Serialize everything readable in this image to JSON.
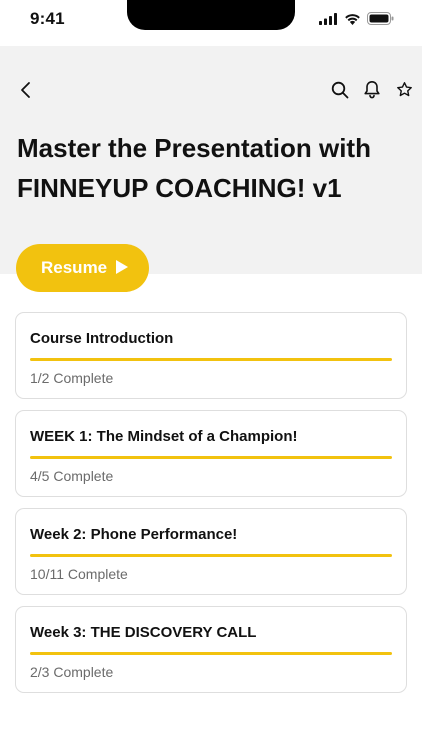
{
  "status_bar": {
    "time": "9:41",
    "icons": [
      "cellular-signal-icon",
      "wifi-icon",
      "battery-icon"
    ]
  },
  "header": {
    "icons": [
      "chevron-left-icon",
      "search-icon",
      "bell-icon",
      "star-icon"
    ]
  },
  "course": {
    "title": "Master the Presentation with FINNEYUP COACHING! v1",
    "resume_label": "Resume"
  },
  "colors": {
    "accent": "#f2c20f",
    "hero_background": "#f2f2f2"
  },
  "modules": [
    {
      "title": "Course Introduction",
      "progress_text": "1/2 Complete",
      "bar_fill": 1.0
    },
    {
      "title": "WEEK 1: The Mindset of a Champion!",
      "progress_text": "4/5 Complete",
      "bar_fill": 1.0
    },
    {
      "title": "Week 2: Phone Performance!",
      "progress_text": "10/11 Complete",
      "bar_fill": 1.0
    },
    {
      "title": "Week 3: THE DISCOVERY CALL",
      "progress_text": "2/3 Complete",
      "bar_fill": 1.0
    }
  ]
}
